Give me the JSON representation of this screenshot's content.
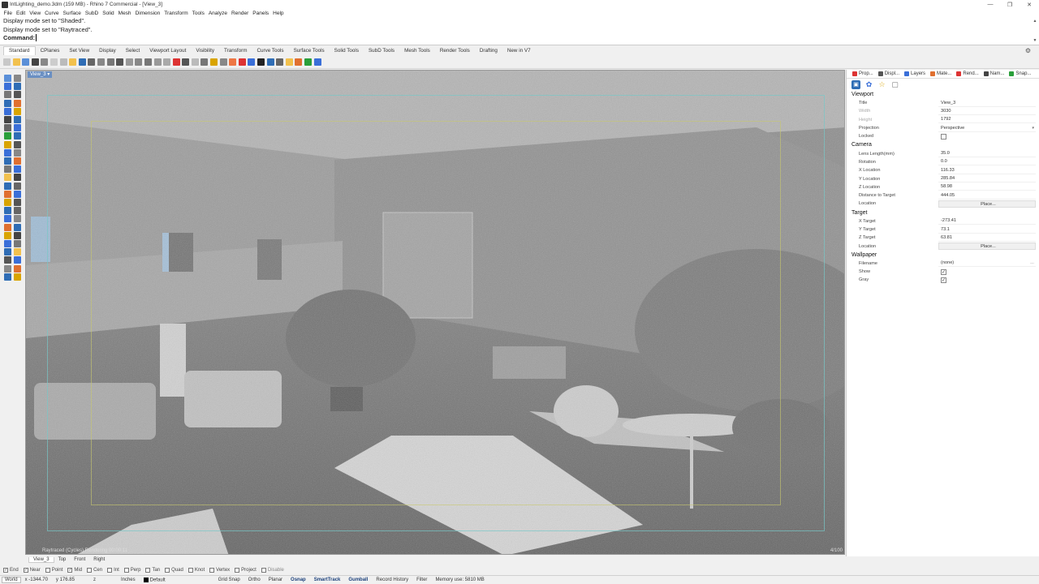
{
  "window": {
    "title": "IntLighting_demo.3dm (159 MB) - Rhino 7 Commercial - [View_3]",
    "minimize": "—",
    "maximize": "❐",
    "close": "✕"
  },
  "menu": [
    "File",
    "Edit",
    "View",
    "Curve",
    "Surface",
    "SubD",
    "Solid",
    "Mesh",
    "Dimension",
    "Transform",
    "Tools",
    "Analyze",
    "Render",
    "Panels",
    "Help"
  ],
  "command": {
    "history": [
      "Display mode set to \"Shaded\".",
      "Display mode set to \"Raytraced\"."
    ],
    "prompt": "Command:"
  },
  "toolbar_tabs": [
    "Standard",
    "CPlanes",
    "Set View",
    "Display",
    "Select",
    "Viewport Layout",
    "Visibility",
    "Transform",
    "Curve Tools",
    "Surface Tools",
    "Solid Tools",
    "SubD Tools",
    "Mesh Tools",
    "Render Tools",
    "Drafting",
    "New in V7"
  ],
  "toolbar_icon_colors": [
    "#c8c8c8",
    "#f2c14e",
    "#5a8fd8",
    "#444",
    "#888",
    "#ccc",
    "#bbb",
    "#f2c14e",
    "#2f6db5",
    "#666",
    "#888",
    "#777",
    "#555",
    "#999",
    "#888",
    "#777",
    "#999",
    "#aaa",
    "#d33",
    "#555",
    "#bbb",
    "#777",
    "#d9a400",
    "#888",
    "#e74",
    "#d33",
    "#3a6fd8",
    "#222",
    "#2f6db5",
    "#666",
    "#f2c14e",
    "#e07030",
    "#2a9f3a",
    "#3a6fd8"
  ],
  "viewport": {
    "name": "View_3",
    "status": "Raytraced (Cycles)   Rendering      00:00:11",
    "pass": "4/100"
  },
  "panel": {
    "tabs": [
      {
        "label": "Prop...",
        "color": "#d33"
      },
      {
        "label": "Displ...",
        "color": "#555"
      },
      {
        "label": "Layers",
        "color": "#3a6fd8"
      },
      {
        "label": "Mate...",
        "color": "#e07030"
      },
      {
        "label": "Rend...",
        "color": "#d33"
      },
      {
        "label": "Nam...",
        "color": "#444"
      },
      {
        "label": "Snap...",
        "color": "#2a9f3a"
      }
    ],
    "viewport": {
      "section": "Viewport",
      "title_label": "Title",
      "title_value": "View_3",
      "width_label": "Width",
      "width_value": "3030",
      "height_label": "Height",
      "height_value": "1792",
      "projection_label": "Projection",
      "projection_value": "Perspective",
      "locked_label": "Locked"
    },
    "camera": {
      "section": "Camera",
      "lens_label": "Lens Length(mm)",
      "lens_value": "35.0",
      "rotation_label": "Rotation",
      "rotation_value": "0.0",
      "x_label": "X Location",
      "x_value": "116.33",
      "y_label": "Y Location",
      "y_value": "285.84",
      "z_label": "Z Location",
      "z_value": "58.98",
      "dist_label": "Distance to Target",
      "dist_value": "444.05",
      "loc_label": "Location",
      "loc_button": "Place..."
    },
    "target": {
      "section": "Target",
      "x_label": "X Target",
      "x_value": "-273.41",
      "y_label": "Y Target",
      "y_value": "73.1",
      "z_label": "Z Target",
      "z_value": "63.81",
      "loc_label": "Location",
      "loc_button": "Place..."
    },
    "wallpaper": {
      "section": "Wallpaper",
      "filename_label": "Filename",
      "filename_value": "(none)",
      "show_label": "Show",
      "gray_label": "Gray"
    }
  },
  "viewport_tabs": [
    "View_3",
    "Top",
    "Front",
    "Right"
  ],
  "osnap": [
    {
      "label": "End",
      "checked": true
    },
    {
      "label": "Near",
      "checked": true
    },
    {
      "label": "Point",
      "checked": false
    },
    {
      "label": "Mid",
      "checked": true
    },
    {
      "label": "Cen",
      "checked": false
    },
    {
      "label": "Int",
      "checked": false
    },
    {
      "label": "Perp",
      "checked": false
    },
    {
      "label": "Tan",
      "checked": false
    },
    {
      "label": "Quad",
      "checked": false
    },
    {
      "label": "Knot",
      "checked": false
    },
    {
      "label": "Vertex",
      "checked": false
    },
    {
      "label": "Project",
      "checked": false
    },
    {
      "label": "Disable",
      "checked": false
    }
  ],
  "status": {
    "cplane": "World",
    "x": "x -1344.70",
    "y": "y 176.85",
    "z": "z",
    "units": "Inches",
    "layer": "Default",
    "grid_snap": "Grid Snap",
    "ortho": "Ortho",
    "planar": "Planar",
    "osnap": "Osnap",
    "smarttrack": "SmartTrack",
    "gumball": "Gumball",
    "history": "Record History",
    "filter": "Filter",
    "memory": "Memory use: 5810 MB"
  }
}
